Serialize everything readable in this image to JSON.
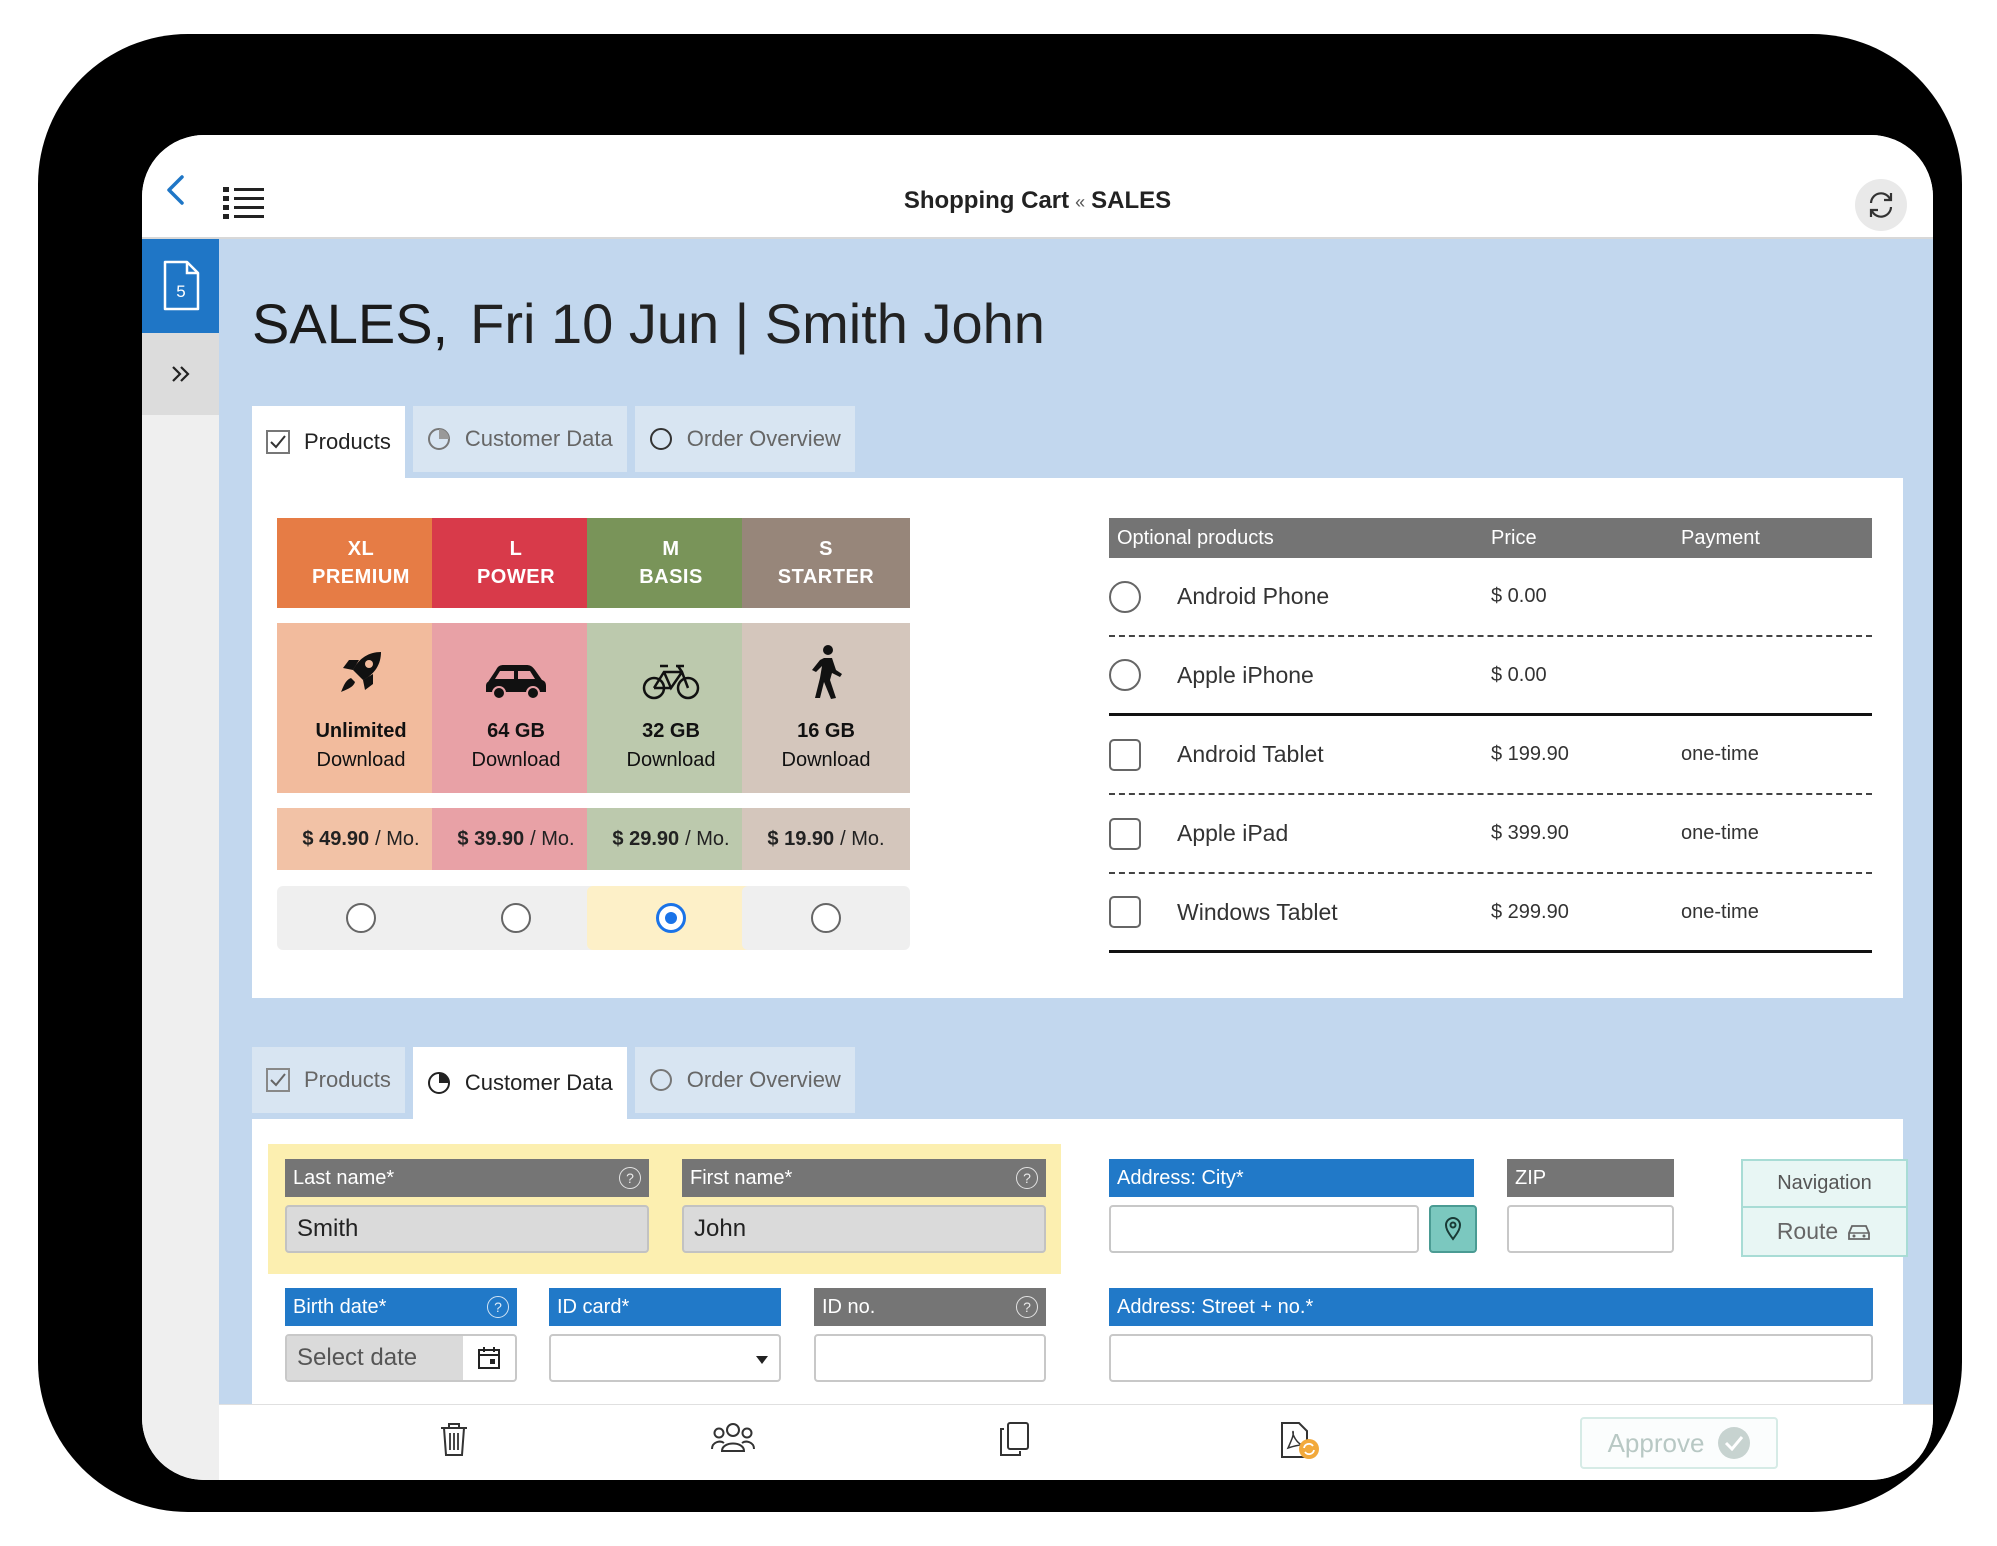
{
  "header": {
    "title_main": "Shopping Cart",
    "title_sep": "«",
    "title_sub": "SALES"
  },
  "sidebar": {
    "doc_badge": "5"
  },
  "headline": {
    "strong": "SALES,",
    "rest": "Fri 10 Jun | Smith John"
  },
  "tabs": [
    {
      "label": "Products"
    },
    {
      "label": "Customer Data"
    },
    {
      "label": "Order Overview"
    }
  ],
  "plans": [
    {
      "code": "XL",
      "name": "PREMIUM",
      "line1": "Unlimited",
      "line2": "Download",
      "price": "$ 49.90",
      "unit": "/ Mo.",
      "selected": false,
      "head_color": "#e67c45",
      "body_color": "#f2bb9d",
      "price_color": "#f2c2a6",
      "icon": "rocket-icon"
    },
    {
      "code": "L",
      "name": "POWER",
      "line1": "64 GB",
      "line2": "Download",
      "price": "$ 39.90",
      "unit": "/ Mo.",
      "selected": false,
      "head_color": "#d83a4a",
      "body_color": "#e8a1a6",
      "price_color": "#e8a1a6",
      "icon": "car-icon"
    },
    {
      "code": "M",
      "name": "BASIS",
      "line1": "32 GB",
      "line2": "Download",
      "price": "$ 29.90",
      "unit": "/ Mo.",
      "selected": true,
      "head_color": "#799459",
      "body_color": "#bcc9ad",
      "price_color": "#bcc9ad",
      "icon": "bicycle-icon"
    },
    {
      "code": "S",
      "name": "STARTER",
      "line1": "16 GB",
      "line2": "Download",
      "price": "$ 19.90",
      "unit": "/ Mo.",
      "selected": false,
      "head_color": "#97867a",
      "body_color": "#d4c6bc",
      "price_color": "#d4c6bc",
      "icon": "walking-icon"
    }
  ],
  "optional": {
    "headers": [
      "Optional products",
      "Price",
      "Payment"
    ],
    "rows": [
      {
        "name": "Android Phone",
        "price": "$ 0.00",
        "payment": "",
        "control": "radio"
      },
      {
        "name": "Apple iPhone",
        "price": "$ 0.00",
        "payment": "",
        "control": "radio"
      },
      {
        "name": "Android Tablet",
        "price": "$ 199.90",
        "payment": "one-time",
        "control": "checkbox"
      },
      {
        "name": "Apple iPad",
        "price": "$ 399.90",
        "payment": "one-time",
        "control": "checkbox"
      },
      {
        "name": "Windows Tablet",
        "price": "$ 299.90",
        "payment": "one-time",
        "control": "checkbox"
      }
    ]
  },
  "customer": {
    "last_name_label": "Last name*",
    "last_name_value": "Smith",
    "first_name_label": "First name*",
    "first_name_value": "John",
    "birth_label": "Birth date*",
    "birth_placeholder": "Select date",
    "idcard_label": "ID card*",
    "idno_label": "ID no.",
    "city_label": "Address: City*",
    "zip_label": "ZIP",
    "street_label": "Address: Street + no.*",
    "nav_label": "Navigation",
    "route_label": "Route",
    "help_glyph": "?"
  },
  "footer": {
    "approve_label": "Approve"
  },
  "colors": {
    "accent": "#2179c8",
    "content_bg": "#c2d7ee"
  }
}
